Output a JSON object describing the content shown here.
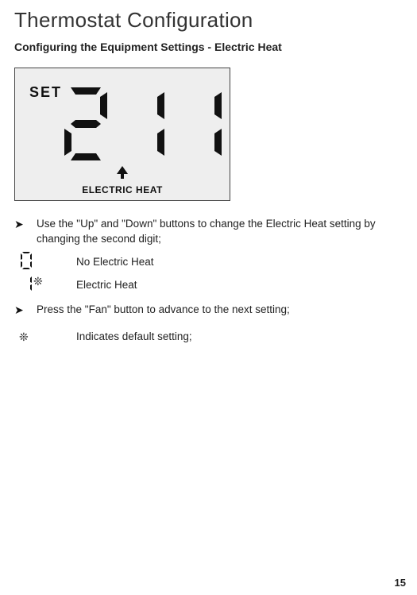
{
  "page": {
    "title": "Thermostat Configuration",
    "subtitle": "Configuring the Equipment Settings - Electric Heat",
    "number": "15"
  },
  "lcd": {
    "set_label": "SET",
    "digits": "211",
    "footer_label": "ELECTRIC HEAT"
  },
  "bullets": {
    "marker": "➤",
    "items": [
      "Use the \"Up\" and \"Down\" buttons to change the Electric Heat setting by changing the second digit;",
      "Press the \"Fan\" button to advance to the next setting;"
    ]
  },
  "options": [
    {
      "code": "0",
      "default": false,
      "label": "No Electric Heat"
    },
    {
      "code": "1",
      "default": true,
      "label": "Electric Heat"
    }
  ],
  "footnote": {
    "marker": "❊",
    "text": "Indicates default setting;"
  }
}
